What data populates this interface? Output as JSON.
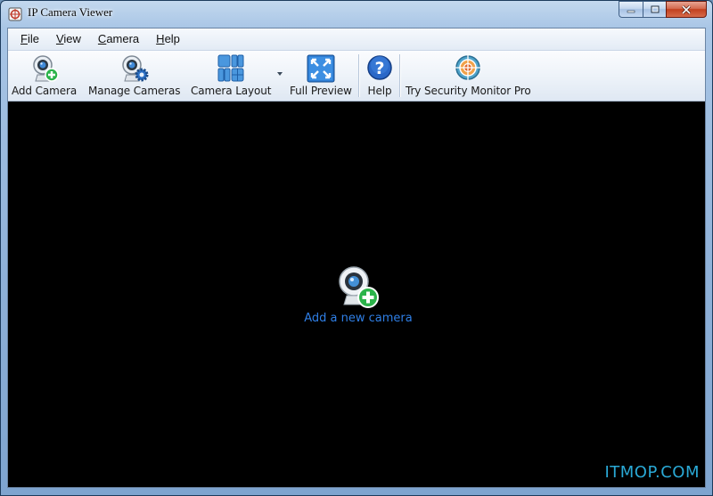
{
  "window": {
    "title": "IP Camera Viewer",
    "controls": {
      "minimize": "minimize-icon",
      "maximize": "maximize-icon",
      "close": "close-icon"
    }
  },
  "menu": {
    "items": [
      {
        "key": "F",
        "rest": "ile"
      },
      {
        "key": "V",
        "rest": "iew"
      },
      {
        "key": "C",
        "rest": "amera"
      },
      {
        "key": "H",
        "rest": "elp"
      }
    ]
  },
  "toolbar": {
    "add_camera": {
      "label": "Add Camera",
      "icon": "webcam-add-icon"
    },
    "manage_cameras": {
      "label": "Manage Cameras",
      "icon": "webcam-gear-icon"
    },
    "camera_layout": {
      "label": "Camera Layout",
      "icon": "grid-layout-icon"
    },
    "full_preview": {
      "label": "Full Preview",
      "icon": "fullscreen-icon"
    },
    "help": {
      "label": "Help",
      "icon": "help-icon"
    },
    "try_pro": {
      "label": "Try Security Monitor Pro",
      "icon": "crosshair-icon"
    }
  },
  "main": {
    "add_new_camera": "Add a new camera",
    "background": "#000000",
    "link_color": "#2f7fe6"
  },
  "watermark": "ITMOP.COM",
  "colors": {
    "accent_green": "#2bb34a",
    "accent_blue": "#1f6fd0"
  }
}
